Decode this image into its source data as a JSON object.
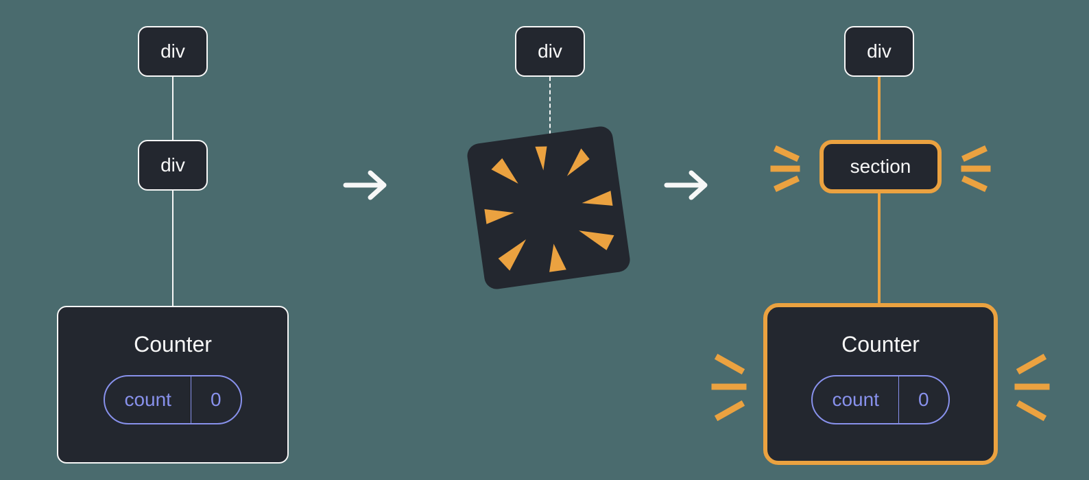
{
  "colors": {
    "bg": "#4a6b6e",
    "node": "#23272f",
    "border_white": "#f7f7f7",
    "border_orange": "#eba240",
    "text": "#f7f7f7",
    "pill": "#8891ec"
  },
  "tree_left": {
    "root": {
      "label": "div"
    },
    "middle": {
      "label": "div"
    },
    "leaf": {
      "title": "Counter",
      "state_key": "count",
      "state_value": "0"
    }
  },
  "tree_middle": {
    "root": {
      "label": "div"
    }
  },
  "tree_right": {
    "root": {
      "label": "div"
    },
    "middle": {
      "label": "section"
    },
    "leaf": {
      "title": "Counter",
      "state_key": "count",
      "state_value": "0"
    }
  }
}
